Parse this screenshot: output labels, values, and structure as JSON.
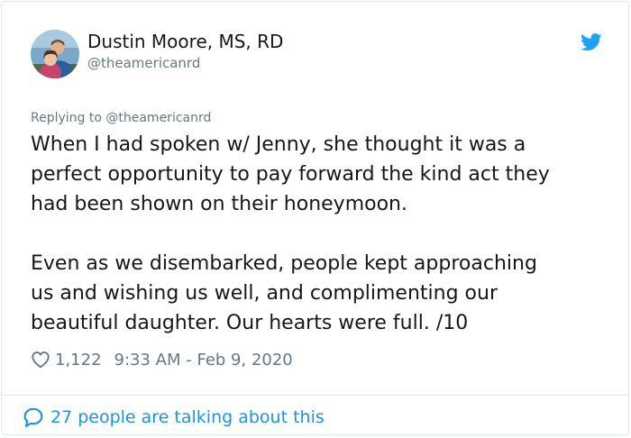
{
  "author": {
    "display_name": "Dustin Moore, MS, RD",
    "handle": "@theamericanrd"
  },
  "reply_context": "Replying to @theamericanrd",
  "tweet": {
    "lines": [
      "When I had spoken w/ Jenny, she thought it was a",
      "perfect opportunity to pay forward the kind act they",
      "had been shown on their honeymoon.",
      "Even as we disembarked, people kept approaching",
      "us and wishing us well, and complimenting our",
      "beautiful daughter. Our hearts were full. /10"
    ]
  },
  "meta": {
    "like_count": "1,122",
    "timestamp": "9:33 AM - Feb 9, 2020"
  },
  "footer": {
    "conversation_label": "27 people are talking about this"
  },
  "icons": {
    "logo": "twitter-bird-icon",
    "like": "heart-icon",
    "conversation": "speech-bubble-icon"
  },
  "colors": {
    "brand": "#1da1f2",
    "link": "#1b95e0",
    "text": "#14171a",
    "muted": "#657786",
    "border": "#e1e8ed"
  }
}
